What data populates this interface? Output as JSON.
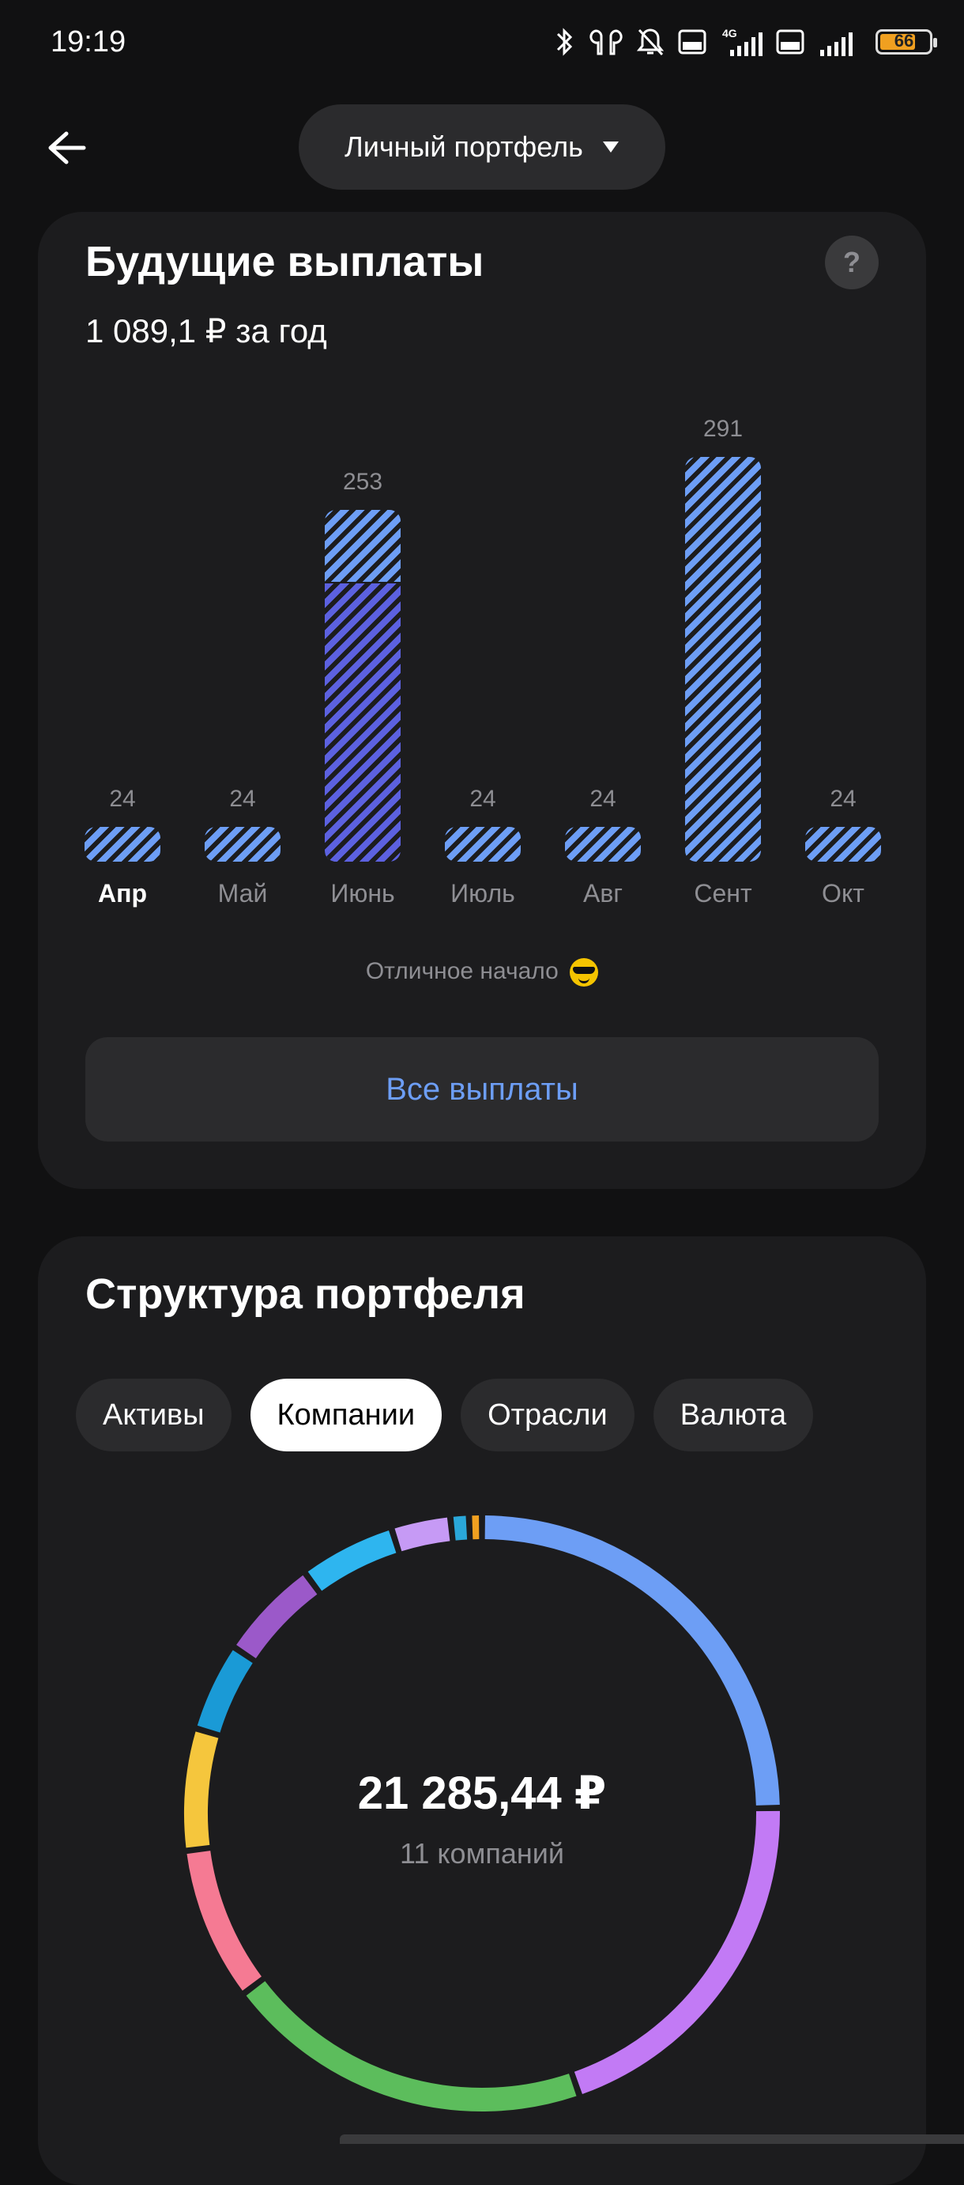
{
  "status_bar": {
    "time": "19:19",
    "battery_level": "66",
    "icons": [
      "bluetooth-icon",
      "earbuds-icon",
      "bell-muted-icon",
      "volte-icon",
      "signal-4g-icon",
      "volte-icon",
      "signal-icon",
      "battery-icon"
    ]
  },
  "header": {
    "portfolio_name": "Личный портфель",
    "dropdown_icon": "caret-down-icon",
    "back_icon": "arrow-left-icon"
  },
  "future_payments": {
    "title": "Будущие выплаты",
    "help_label": "?",
    "total_label": "1 089,1 ₽ за год",
    "note": "Отличное начало",
    "note_emoji": "sunglasses-emoji",
    "all_button": "Все выплаты"
  },
  "chart_data": {
    "type": "bar",
    "categories": [
      "Апр",
      "Май",
      "Июнь",
      "Июль",
      "Авг",
      "Сент",
      "Окт"
    ],
    "values": [
      24,
      24,
      253,
      24,
      24,
      291,
      24
    ],
    "value_labels": [
      "24",
      "24",
      "253",
      "24",
      "24",
      "291",
      "24"
    ],
    "active_category": "Апр",
    "stacked_segment": {
      "category": "Июнь",
      "lower_fraction": 0.79
    },
    "colors": {
      "bar": "#6d9ef5",
      "bar_alt": "#5c61e0"
    }
  },
  "structure": {
    "title": "Структура портфеля",
    "tabs": [
      {
        "label": "Активы",
        "active": false
      },
      {
        "label": "Компании",
        "active": true
      },
      {
        "label": "Отрасли",
        "active": false
      },
      {
        "label": "Валюта",
        "active": false
      }
    ],
    "total": "21 285,44 ₽",
    "count_label": "11 компаний",
    "donut_segments": [
      {
        "fraction": 0.247,
        "color": "#6d9ef5"
      },
      {
        "fraction": 0.2,
        "color": "#c27af5"
      },
      {
        "fraction": 0.2,
        "color": "#5cbd5c"
      },
      {
        "fraction": 0.083,
        "color": "#f57a93"
      },
      {
        "fraction": 0.066,
        "color": "#f5c63d"
      },
      {
        "fraction": 0.048,
        "color": "#1a9ad6"
      },
      {
        "fraction": 0.055,
        "color": "#9b59c9"
      },
      {
        "fraction": 0.052,
        "color": "#2eb5ef"
      },
      {
        "fraction": 0.032,
        "color": "#c69af5"
      },
      {
        "fraction": 0.01,
        "color": "#2aa7d9"
      },
      {
        "fraction": 0.007,
        "color": "#f0a020"
      }
    ]
  }
}
